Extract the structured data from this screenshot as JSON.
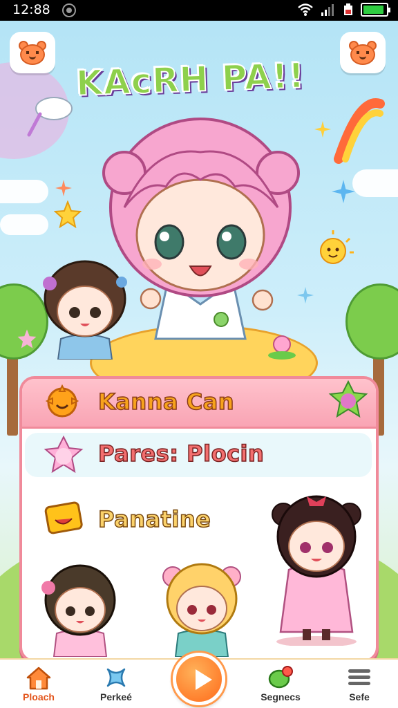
{
  "status_bar": {
    "time": "12:88"
  },
  "header": {
    "logo_text": "KAcRH PA!!"
  },
  "panel": {
    "title": "Kanna Can",
    "row_two": "Pares: Plocin",
    "row_three": "Panatine"
  },
  "nav": {
    "items": [
      {
        "label": "Ploach",
        "icon": "home-icon",
        "active": true
      },
      {
        "label": "Perkeé",
        "icon": "cross-icon",
        "active": false
      },
      {
        "label": "",
        "icon": "play-icon",
        "active": false
      },
      {
        "label": "Segnecs",
        "icon": "leaf-icon",
        "active": false
      },
      {
        "label": "Sefe",
        "icon": "menu-icon",
        "active": false
      }
    ]
  },
  "colors": {
    "accent_orange": "#ff6a1a",
    "panel_border": "#f08a9a",
    "hair_pink": "#f7a6cf",
    "sky": "#b4e4f6"
  }
}
